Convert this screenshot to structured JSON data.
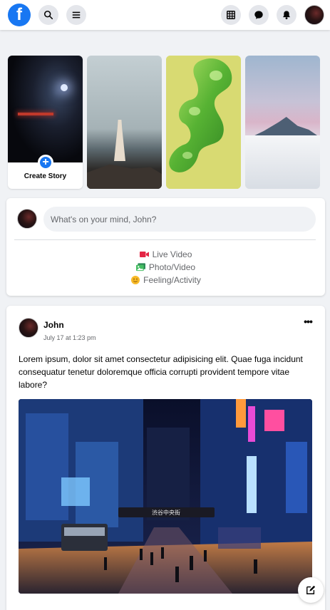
{
  "topbar": {
    "logo_letter": "f",
    "left_buttons": [
      "search-icon",
      "menu-icon"
    ],
    "right_buttons": [
      "grid-icon",
      "messenger-icon",
      "bell-icon"
    ]
  },
  "stories": {
    "create_label": "Create Story",
    "plus_glyph": "+"
  },
  "composer": {
    "placeholder": "What's on your mind, John?",
    "actions": [
      {
        "label": "Live Video",
        "icon": "video-camera-icon",
        "color": "#e42645"
      },
      {
        "label": "Photo/Video",
        "icon": "photo-icon",
        "color": "#45bd62"
      },
      {
        "label": "Feeling/Activity",
        "icon": "smiley-icon",
        "color": "#f7b928"
      }
    ]
  },
  "post": {
    "author": "John",
    "timestamp": "July 17 at 1:23 pm",
    "more": "•••",
    "text": "Lorem ipsum, dolor sit amet consectetur adipisicing elit. Quae fuga incidunt consequatur tenetur doloremque officia corrupti provident tempore vitae labore?",
    "image_sign": "渋谷中央街"
  },
  "colors": {
    "brand": "#1877f2",
    "background": "#f0f2f5",
    "card": "#ffffff",
    "secondary_text": "#65676b"
  }
}
